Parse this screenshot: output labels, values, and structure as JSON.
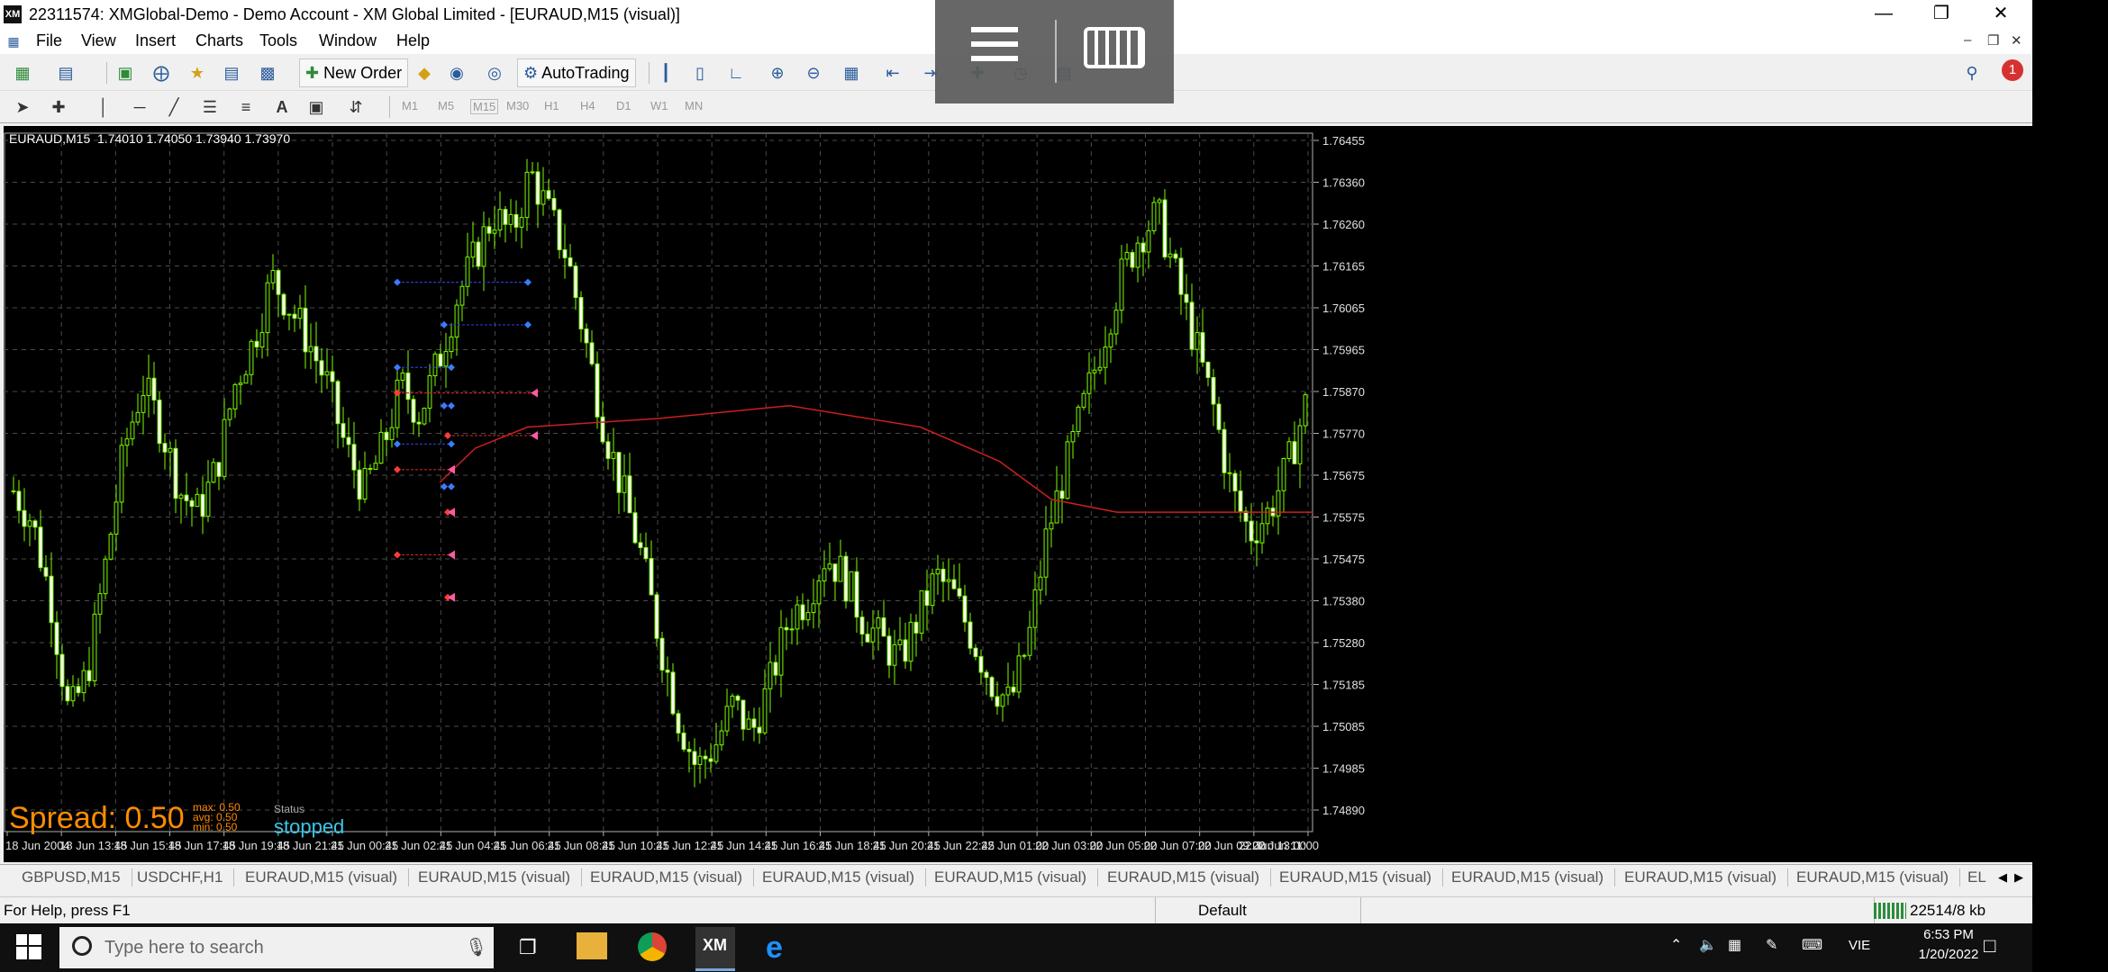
{
  "app": {
    "title": "22311574: XMGlobal-Demo - Demo Account - XM Global Limited - [EURAUD,M15 (visual)]",
    "icon_label": "XM"
  },
  "menu": [
    "File",
    "View",
    "Insert",
    "Charts",
    "Tools",
    "Window",
    "Help"
  ],
  "toolbar": {
    "new_order_label": "New Order",
    "autotrading_label": "AutoTrading",
    "notification_count": "1"
  },
  "timeframes": [
    "M1",
    "M5",
    "M15",
    "M30",
    "H1",
    "H4",
    "D1",
    "W1",
    "MN"
  ],
  "chart": {
    "symbol_info": "EURAUD,M15  1.74010 1.74050 1.73940 1.73970",
    "spread_label": "Spread: 0.50",
    "spread_stats": [
      "max: 0.50",
      "avg: 0.50",
      "min: 0.50"
    ],
    "status_label": "Status",
    "status_value": "stopped",
    "bull_color": "#7cfc00",
    "bear_color": "#7cfc00",
    "ma_color": "#cc1f1f"
  },
  "chart_data": {
    "type": "candlestick",
    "symbol": "EURAUD",
    "timeframe": "M15",
    "y_ticks": [
      "1.76455",
      "1.76360",
      "1.76260",
      "1.76165",
      "1.76065",
      "1.75965",
      "1.75870",
      "1.75770",
      "1.75675",
      "1.75575",
      "1.75475",
      "1.75380",
      "1.75280",
      "1.75185",
      "1.75085",
      "1.74985",
      "1.74890"
    ],
    "x_ticks": [
      "18 Jun 2004",
      "18 Jun 13:45",
      "18 Jun 15:45",
      "18 Jun 17:45",
      "18 Jun 19:45",
      "18 Jun 21:45",
      "21 Jun 00:45",
      "21 Jun 02:45",
      "21 Jun 04:45",
      "21 Jun 06:45",
      "21 Jun 08:45",
      "21 Jun 10:45",
      "21 Jun 12:45",
      "21 Jun 14:45",
      "21 Jun 16:45",
      "21 Jun 18:45",
      "21 Jun 20:45",
      "21 Jun 22:45",
      "22 Jun 01:00",
      "22 Jun 03:00",
      "22 Jun 05:00",
      "22 Jun 07:00",
      "22 Jun 09:00",
      "22 Jun 11:00",
      "22 Jun 13:00"
    ],
    "ylim": [
      1.7485,
      1.7649
    ],
    "close_path": [
      1.7565,
      1.7558,
      1.754,
      1.7512,
      1.7522,
      1.7548,
      1.7575,
      1.759,
      1.758,
      1.7565,
      1.756,
      1.757,
      1.759,
      1.76,
      1.7615,
      1.7608,
      1.76,
      1.759,
      1.7575,
      1.7565,
      1.7575,
      1.759,
      1.7583,
      1.7595,
      1.761,
      1.762,
      1.763,
      1.7625,
      1.764,
      1.763,
      1.762,
      1.76,
      1.758,
      1.7565,
      1.755,
      1.753,
      1.7512,
      1.75,
      1.7505,
      1.7515,
      1.7508,
      1.752,
      1.7535,
      1.754,
      1.755,
      1.7545,
      1.7535,
      1.753,
      1.7525,
      1.7535,
      1.7545,
      1.754,
      1.753,
      1.752,
      1.7515,
      1.753,
      1.7555,
      1.757,
      1.7585,
      1.76,
      1.7615,
      1.7625,
      1.763,
      1.7615,
      1.76,
      1.7585,
      1.7565,
      1.7555,
      1.756,
      1.757,
      1.7585
    ],
    "ma_path": [
      [
        0.333,
        1.7567
      ],
      [
        0.36,
        1.7575
      ],
      [
        0.4,
        1.758
      ],
      [
        0.5,
        1.7582
      ],
      [
        0.6,
        1.7585
      ],
      [
        0.7,
        1.758
      ],
      [
        0.76,
        1.7572
      ],
      [
        0.8,
        1.7563
      ],
      [
        0.85,
        1.756
      ],
      [
        0.9,
        1.756
      ],
      [
        1.0,
        1.756
      ]
    ]
  },
  "tabs": [
    "GBPUSD,M15",
    "USDCHF,H1",
    "EURAUD,M15 (visual)",
    "EURAUD,M15 (visual)",
    "EURAUD,M15 (visual)",
    "EURAUD,M15 (visual)",
    "EURAUD,M15 (visual)",
    "EURAUD,M15 (visual)",
    "EURAUD,M15 (visual)",
    "EURAUD,M15 (visual)",
    "EURAUD,M15 (visual)",
    "EURAUD,M15 (visual)",
    "EL"
  ],
  "statusbar": {
    "help": "For Help, press F1",
    "profile": "Default",
    "traffic": "22514/8 kb"
  },
  "taskbar": {
    "search_placeholder": "Type here to search",
    "time": "6:53 PM",
    "date": "1/20/2022",
    "lang": "VIE"
  }
}
